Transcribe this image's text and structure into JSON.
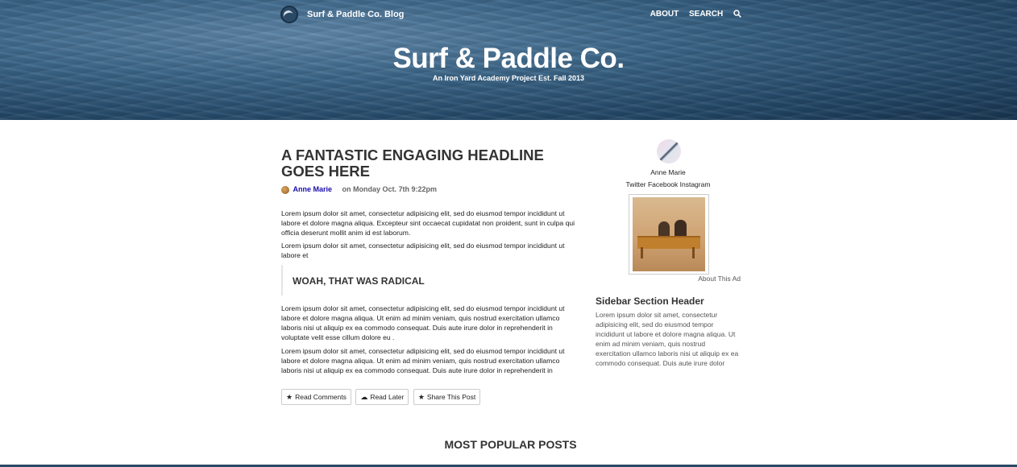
{
  "nav": {
    "brand": "Surf & Paddle Co. Blog",
    "links": [
      "ABOUT",
      "SEARCH"
    ]
  },
  "hero": {
    "title": "Surf & Paddle Co.",
    "subtitle": "An Iron Yard Academy Project Est. Fall 2013"
  },
  "article": {
    "headline": "A FANTASTIC ENGAGING HEADLINE GOES HERE",
    "author": "Anne Marie",
    "date": "on Monday Oct. 7th 9:22pm",
    "paragraphs": [
      "Lorem ipsum dolor sit amet, consectetur adipisicing elit, sed do eiusmod tempor incididunt ut labore et dolore magna aliqua. Excepteur sint occaecat cupidatat non proident, sunt in culpa qui officia deserunt mollit anim id est laborum.",
      "Lorem ipsum dolor sit amet, consectetur adipisicing elit, sed do eiusmod tempor incididunt ut labore et",
      "Lorem ipsum dolor sit amet, consectetur adipisicing elit, sed do eiusmod tempor incididunt ut labore et dolore magna aliqua. Ut enim ad minim veniam, quis nostrud exercitation ullamco laboris nisi ut aliquip ex ea commodo consequat. Duis aute irure dolor in reprehenderit in voluptate velit esse cillum dolore eu .",
      "Lorem ipsum dolor sit amet, consectetur adipisicing elit, sed do eiusmod tempor incididunt ut labore et dolore magna aliqua. Ut enim ad minim veniam, quis nostrud exercitation ullamco laboris nisi ut aliquip ex ea commodo consequat. Duis aute irure dolor in reprehenderit in"
    ],
    "quote": "WOAH, THAT WAS RADICAL",
    "buttons": {
      "read_comments": "Read Comments",
      "read_later": "Read Later",
      "share": "Share This Post"
    }
  },
  "sidebar": {
    "profile_name": "Anne Marie",
    "profile_links": "Twitter Facebook Instagram",
    "ad_label": "About This Ad",
    "section_header": "Sidebar Section Header",
    "section_text": "Lorem ipsum dolor sit amet, consectetur adipisicing elit, sed do eiusmod tempor incididunt ut labore et dolore magna aliqua. Ut enim ad minim veniam, quis nostrud exercitation ullamco laboris nisi ut aliquip ex ea commodo consequat. Duis aute irure dolor"
  },
  "popular": {
    "title": "MOST POPULAR POSTS"
  }
}
